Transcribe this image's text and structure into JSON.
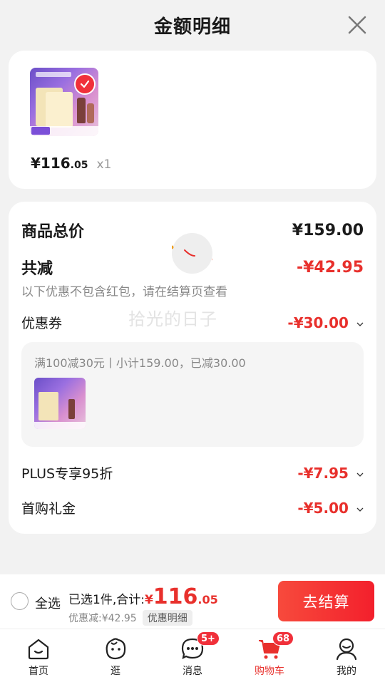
{
  "header": {
    "title": "金额明细"
  },
  "item": {
    "yen": "¥",
    "price_int": "116",
    "price_dec": ".05",
    "qty": "x1"
  },
  "summary": {
    "total_label": "商品总价",
    "total_value": "¥159.00",
    "reduce_label": "共减",
    "reduce_value": "-¥42.95",
    "reduce_note": "以下优惠不包含红包，请在结算页查看",
    "coupon_label": "优惠券",
    "coupon_value": "-¥30.00",
    "coupon_detail": "满100减30元丨小计159.00，已减30.00",
    "plus_label": "PLUS专享95折",
    "plus_value": "-¥7.95",
    "first_label": "首购礼金",
    "first_value": "-¥5.00"
  },
  "watermark": "拾光的日子",
  "bottom": {
    "select_all": "全选",
    "selected_text": "已选1件,合计:",
    "total_yen": "¥",
    "total_int": "116",
    "total_dec": ".05",
    "saved_text": "优惠减:¥42.95",
    "detail_chip": "优惠明细",
    "checkout": "去结算"
  },
  "tabs": [
    {
      "label": "首页",
      "icon": "home-icon"
    },
    {
      "label": "逛",
      "icon": "browse-icon"
    },
    {
      "label": "消息",
      "icon": "message-icon",
      "badge": "5+"
    },
    {
      "label": "购物车",
      "icon": "cart-icon",
      "badge": "68",
      "active": true
    },
    {
      "label": "我的",
      "icon": "profile-icon"
    }
  ],
  "colors": {
    "accent": "#e8302c",
    "background": "#f2f2f2"
  }
}
